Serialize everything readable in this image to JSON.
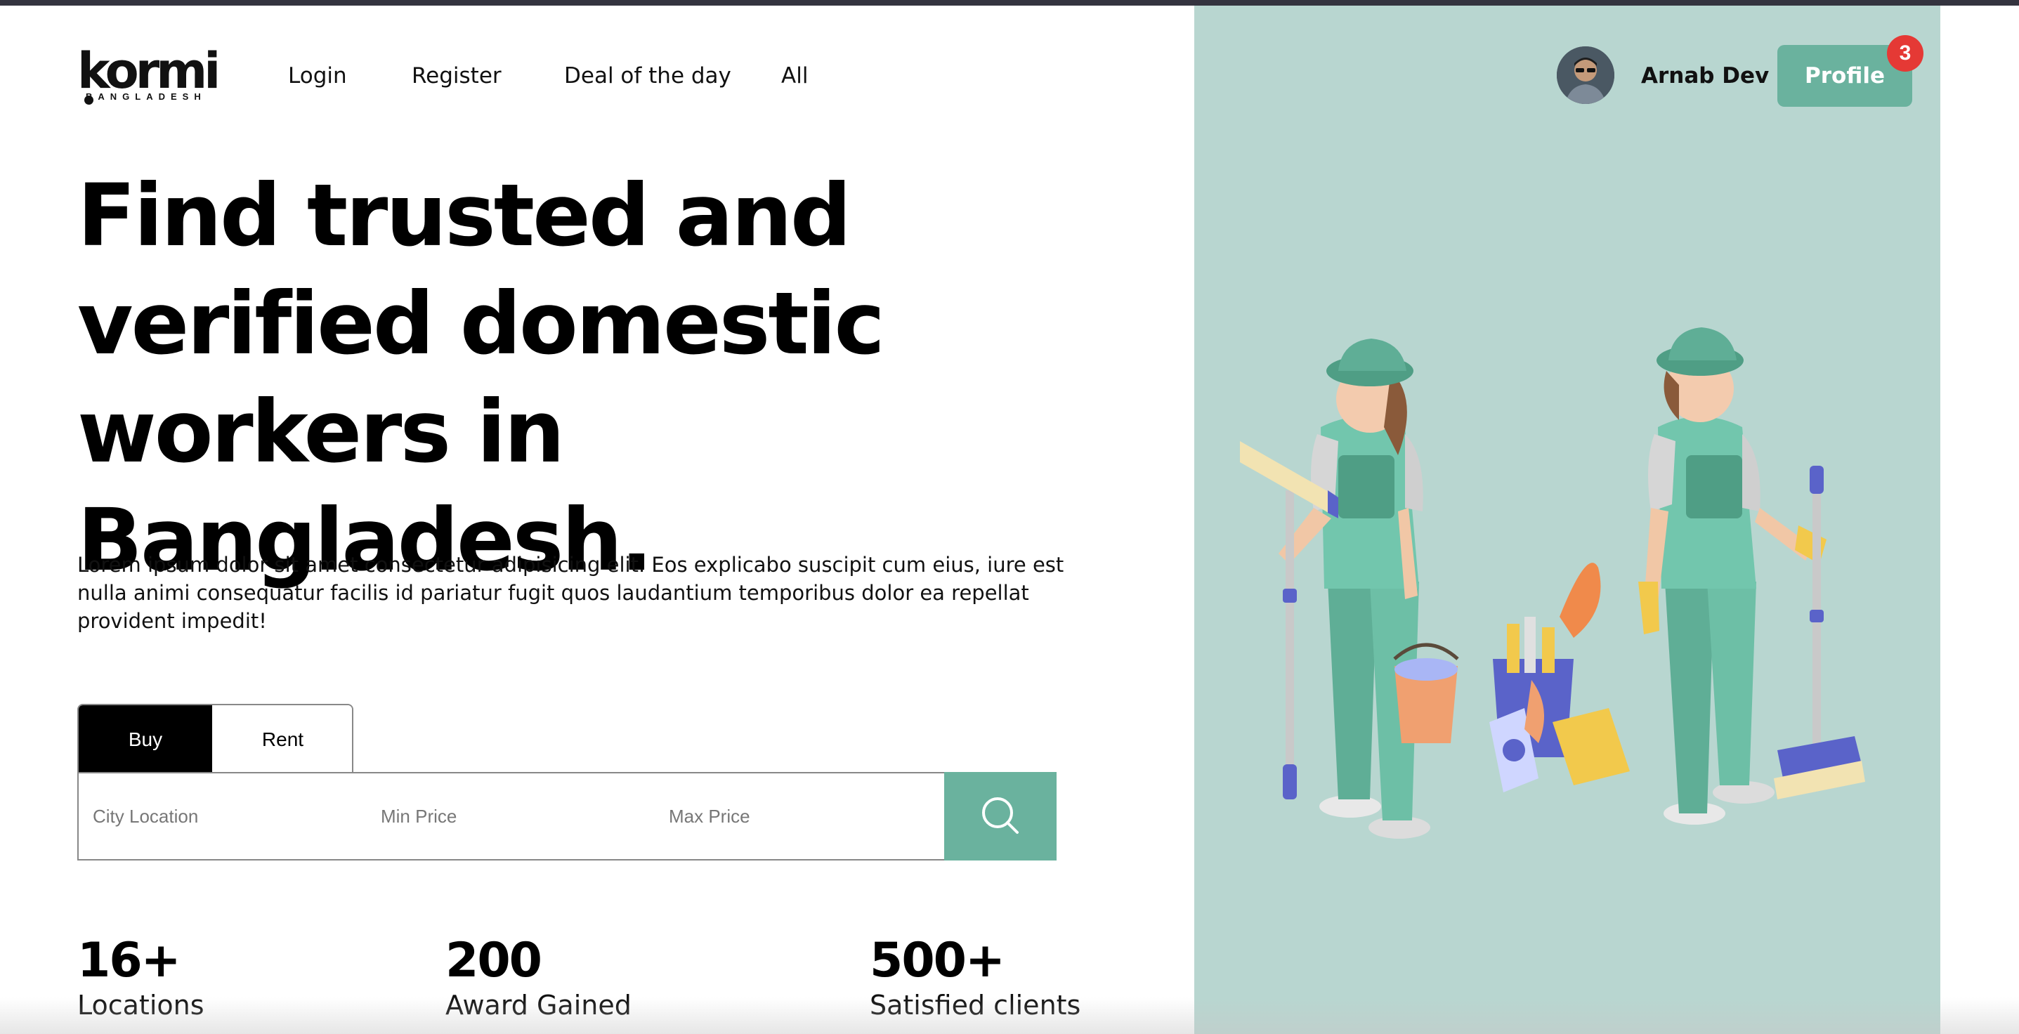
{
  "brand": {
    "name": "kormi",
    "tagline": "BANGLADESH"
  },
  "nav": {
    "items": [
      "Login",
      "Register",
      "Deal of the day",
      "All"
    ]
  },
  "user": {
    "name": "Arnab Dev",
    "profile_label": "Profile",
    "notification_count": "3"
  },
  "hero": {
    "headline_lines": [
      "Find trusted and",
      "verified domestic",
      "workers in Bangladesh."
    ],
    "description": "Lorem ipsum dolor sit amet consectetur adipisicing elit. Eos explicabo suscipit cum eius, iure est nulla animi consequatur facilis id pariatur fugit quos laudantium temporibus dolor ea repellat provident impedit!"
  },
  "search": {
    "tabs": [
      "Buy",
      "Rent"
    ],
    "active_tab": "Buy",
    "city_placeholder": "City Location",
    "min_price_placeholder": "Min Price",
    "max_price_placeholder": "Max Price",
    "button_icon": "search-icon"
  },
  "stats": [
    {
      "value": "16+",
      "label": "Locations"
    },
    {
      "value": "200",
      "label": "Award Gained"
    },
    {
      "value": "500+",
      "label": "Satisfied clients"
    }
  ],
  "colors": {
    "accent": "#6ab29e",
    "panel": "#b8d6d0",
    "badge": "#e53935",
    "tab_active": "#000000"
  },
  "icons": {
    "illustration": "cleaning-workers-illustration",
    "avatar": "user-avatar"
  }
}
